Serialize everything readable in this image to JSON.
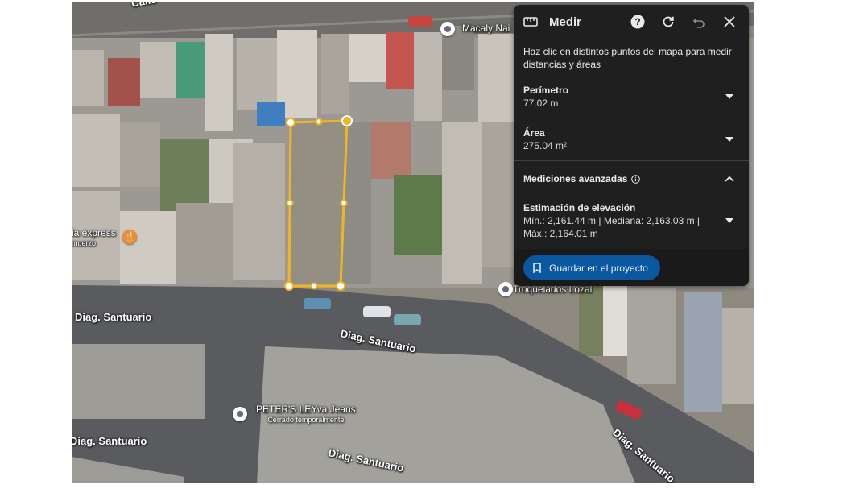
{
  "map": {
    "street_labels": [
      "Diag. Santuario",
      "Diag. Santuario",
      "Diag. Santuario",
      "Diag. Santuario",
      "Calle"
    ],
    "pois": [
      {
        "name": "Macaly Nai",
        "sub": ""
      },
      {
        "name": "Troquelados Lozal",
        "sub": ""
      },
      {
        "name": "PETER'S LEYva Jeans",
        "sub": "Cerrado temporalmente"
      },
      {
        "name": "ia express",
        "sub": "muerzo"
      }
    ]
  },
  "panel": {
    "title": "Medir",
    "description": "Haz clic en distintos puntos del mapa para medir distancias y áreas",
    "perimeter": {
      "label": "Perímetro",
      "value": "77.02 m"
    },
    "area": {
      "label": "Área",
      "value": "275.04 m²"
    },
    "advanced": {
      "label": "Mediciones avanzadas"
    },
    "elevation": {
      "label": "Estimación de elevación",
      "line1": "Mín.: 2,161.44 m | Mediana: 2,163.03 m |",
      "line2": "Máx.: 2,164.01 m"
    },
    "save_label": "Guardar en el proyecto",
    "accent": "#0b57a0",
    "measure_color": "#f2b51f"
  },
  "icons": [
    "ruler-icon",
    "help-icon",
    "refresh-icon",
    "undo-icon",
    "close-icon",
    "chevron-down-icon",
    "chevron-up-icon",
    "info-icon",
    "bookmark-icon",
    "place-pin-icon",
    "restaurant-icon",
    "lock-pin-icon"
  ]
}
